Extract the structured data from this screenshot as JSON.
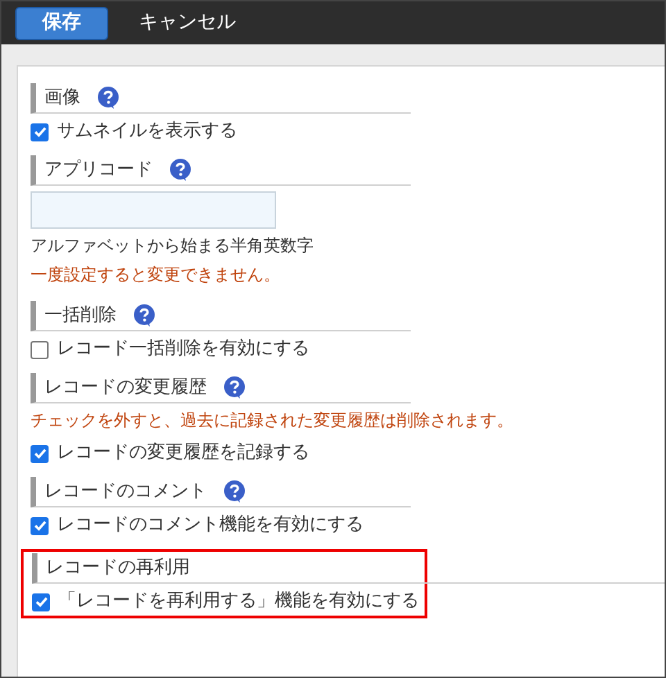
{
  "toolbar": {
    "save": "保存",
    "cancel": "キャンセル"
  },
  "sections": [
    {
      "title": "画像",
      "help": true,
      "highlighted": false,
      "items": [
        {
          "kind": "checkbox",
          "label": "サムネイルを表示する",
          "checked": true
        }
      ]
    },
    {
      "title": "アプリコード",
      "help": true,
      "highlighted": false,
      "items": [
        {
          "kind": "input"
        },
        {
          "kind": "note",
          "text": "アルファベットから始まる半角英数字"
        },
        {
          "kind": "warning",
          "text": "一度設定すると変更できません。"
        }
      ]
    },
    {
      "title": "一括削除",
      "help": true,
      "highlighted": false,
      "items": [
        {
          "kind": "checkbox",
          "label": "レコード一括削除を有効にする",
          "checked": false
        }
      ]
    },
    {
      "title": "レコードの変更履歴",
      "help": true,
      "highlighted": false,
      "items": [
        {
          "kind": "warning",
          "text": "チェックを外すと、過去に記録された変更履歴は削除されます。"
        },
        {
          "kind": "checkbox",
          "label": "レコードの変更履歴を記録する",
          "checked": true
        }
      ]
    },
    {
      "title": "レコードのコメント",
      "help": true,
      "highlighted": false,
      "items": [
        {
          "kind": "checkbox",
          "label": "レコードのコメント機能を有効にする",
          "checked": true
        }
      ]
    },
    {
      "title": "レコードの再利用",
      "help": false,
      "highlighted": true,
      "items": [
        {
          "kind": "checkbox",
          "label": "「レコードを再利用する」機能を有効にする",
          "checked": true
        }
      ]
    }
  ]
}
